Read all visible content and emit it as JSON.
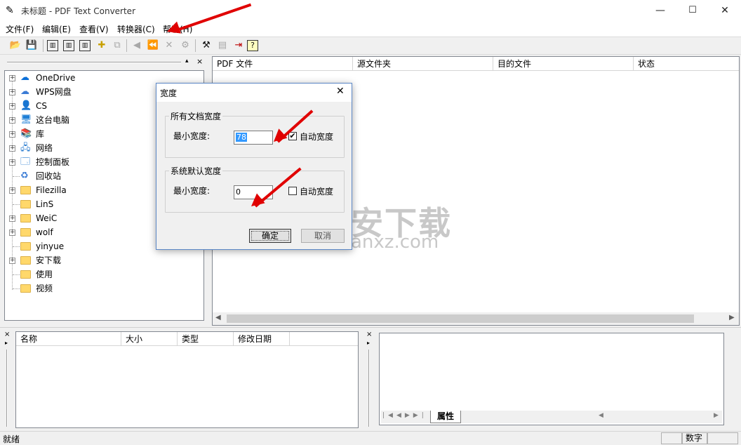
{
  "window": {
    "title": "未标题 - PDF Text Converter",
    "min": "—",
    "max": "☐",
    "close": "✕"
  },
  "menu": [
    "文件(F)",
    "编辑(E)",
    "查看(V)",
    "转换器(C)",
    "帮助(H)"
  ],
  "toolbar": {
    "open": "open-icon",
    "save": "save-icon",
    "view1": "view-icon",
    "view2": "view-icon",
    "view3": "view-icon",
    "add": "add-icon",
    "copy": "copy-icon",
    "back": "back-icon",
    "back2": "back-icon",
    "delete": "delete-icon",
    "settings": "gear-icon",
    "hammer": "hammer-icon",
    "properties": "properties-icon",
    "exit": "exit-icon",
    "help": "help-icon"
  },
  "tree": [
    {
      "label": "OneDrive",
      "expand": true,
      "icon": "onedrive"
    },
    {
      "label": "WPS网盘",
      "expand": true,
      "icon": "cloud"
    },
    {
      "label": "CS",
      "expand": true,
      "icon": "user"
    },
    {
      "label": "这台电脑",
      "expand": true,
      "icon": "pc"
    },
    {
      "label": "库",
      "expand": true,
      "icon": "library"
    },
    {
      "label": "网络",
      "expand": true,
      "icon": "network"
    },
    {
      "label": "控制面板",
      "expand": true,
      "icon": "control"
    },
    {
      "label": "回收站",
      "expand": false,
      "icon": "recycle"
    },
    {
      "label": "Filezilla",
      "expand": true,
      "icon": "folder"
    },
    {
      "label": "LinS",
      "expand": false,
      "icon": "folder"
    },
    {
      "label": "WeiC",
      "expand": true,
      "icon": "folder"
    },
    {
      "label": "wolf",
      "expand": true,
      "icon": "folder"
    },
    {
      "label": "yinyue",
      "expand": false,
      "icon": "folder"
    },
    {
      "label": "安下载",
      "expand": true,
      "icon": "folder"
    },
    {
      "label": "使用",
      "expand": false,
      "icon": "folder"
    },
    {
      "label": "视频",
      "expand": false,
      "icon": "folder"
    }
  ],
  "main_columns": [
    "PDF 文件",
    "源文件夹",
    "目的文件",
    "状态"
  ],
  "file_columns": [
    "名称",
    "大小",
    "类型",
    "修改日期"
  ],
  "props_tab": "属性",
  "dialog": {
    "title": "宽度",
    "group1": {
      "legend": "所有文档宽度",
      "label": "最小宽度:",
      "value": "78",
      "auto_label": "自动宽度",
      "auto_checked": "✔"
    },
    "group2": {
      "legend": "系统默认宽度",
      "label": "最小宽度:",
      "value": "0",
      "auto_label": "自动宽度",
      "auto_checked": ""
    },
    "ok": "确定",
    "cancel": "取消"
  },
  "watermark": {
    "text": "安下载",
    "sub": "anxz.com"
  },
  "status": {
    "left": "就绪",
    "right": "数字"
  },
  "colors": {
    "arrow": "#e00000",
    "dialog_border": "#5b87c6",
    "selection": "#3399ff"
  }
}
